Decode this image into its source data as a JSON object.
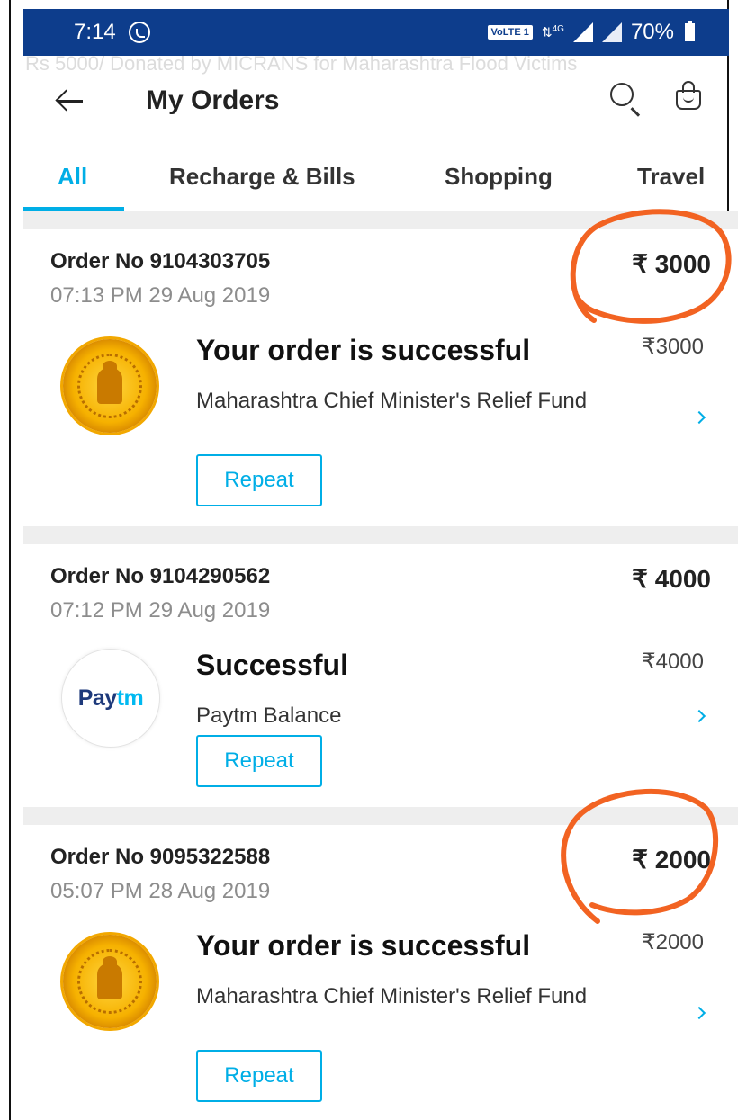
{
  "status_bar": {
    "time": "7:14",
    "network_badge": "VoLTE 1",
    "network_type": "4G",
    "battery": "70%"
  },
  "watermark": "Rs 5000/ Donated by MICRANS for Maharashtra Flood Victims",
  "header": {
    "title": "My Orders"
  },
  "tabs": [
    {
      "label": "All",
      "active": true
    },
    {
      "label": "Recharge & Bills",
      "active": false
    },
    {
      "label": "Shopping",
      "active": false
    },
    {
      "label": "Travel",
      "active": false
    }
  ],
  "orders": [
    {
      "order_no": "Order No 9104303705",
      "time": "07:13 PM 29 Aug 2019",
      "total": "₹ 3000",
      "status": "Your order is successful",
      "merchant": "Maharashtra Chief Minister's Relief Fund",
      "amount": "₹3000",
      "button": "Repeat",
      "logo": "maharashtra-emblem",
      "annotated": true
    },
    {
      "order_no": "Order No 9104290562",
      "time": "07:12 PM 29 Aug 2019",
      "total": "₹ 4000",
      "status": "Successful",
      "merchant": "Paytm Balance",
      "amount": "₹4000",
      "button": "Repeat",
      "logo": "paytm",
      "annotated": false
    },
    {
      "order_no": "Order No 9095322588",
      "time": "05:07 PM 28 Aug 2019",
      "total": "₹ 2000",
      "status": "Your order is successful",
      "merchant": "Maharashtra Chief Minister's Relief Fund",
      "amount": "₹2000",
      "button": "Repeat",
      "logo": "maharashtra-emblem",
      "annotated": true
    }
  ],
  "paytm_logo": {
    "pay": "Pay",
    "tm": "tm"
  },
  "colors": {
    "status_bar": "#0d3d8c",
    "accent": "#00aee6",
    "annotation": "#f26322",
    "divider": "#eeeeee"
  }
}
